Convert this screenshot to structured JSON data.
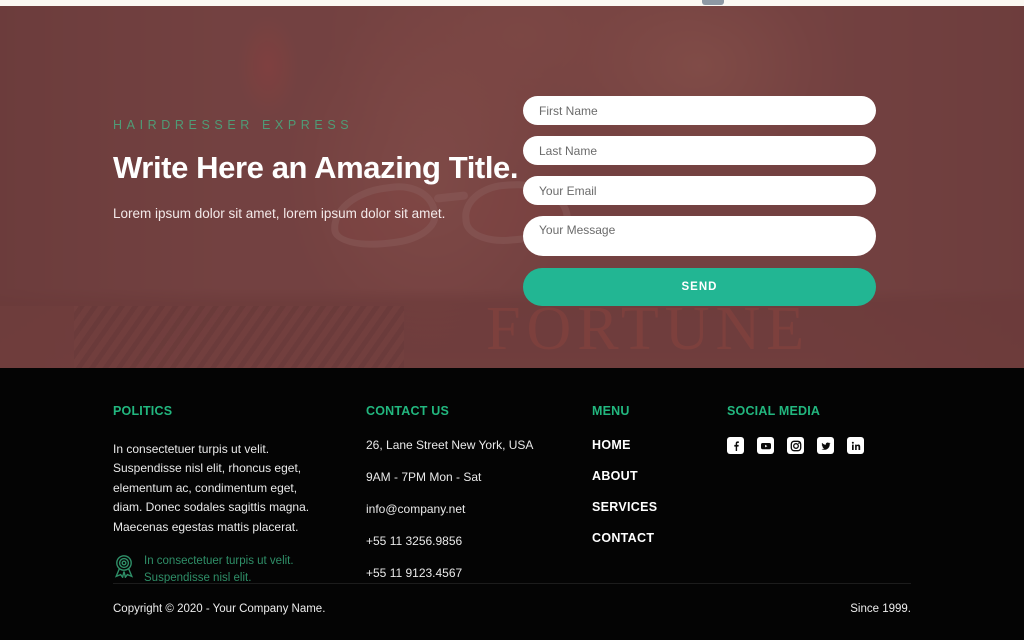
{
  "colors": {
    "accent_green": "#22b693",
    "footer_heading_green": "#22b77f",
    "hero_overlay": "#754343",
    "footer_bg": "#040404",
    "white": "#ffffff"
  },
  "hero": {
    "eyebrow": "HAIRDRESSER EXPRESS",
    "title": "Write Here an Amazing Title.",
    "subtitle": "Lorem ipsum dolor sit amet, lorem ipsum dolor sit amet.",
    "magazine_masthead": "FORTUNE",
    "form": {
      "first_name": {
        "placeholder": "First Name",
        "value": ""
      },
      "last_name": {
        "placeholder": "Last Name",
        "value": ""
      },
      "email": {
        "placeholder": "Your Email",
        "value": ""
      },
      "message": {
        "placeholder": "Your Message",
        "value": ""
      },
      "send_label": "SEND"
    }
  },
  "footer": {
    "politics": {
      "heading": "POLITICS",
      "body": "In consectetuer turpis ut velit. Suspendisse nisl elit, rhoncus eget, elementum ac, condimentum eget, diam. Donec sodales sagittis magna. Maecenas egestas mattis placerat.",
      "award_icon": "award-badge-icon",
      "award_text": "In consectetuer turpis ut velit. Suspendisse nisl elit."
    },
    "contact": {
      "heading": "CONTACT US",
      "lines": [
        "26, Lane Street New York, USA",
        "9AM - 7PM Mon - Sat",
        "info@company.net",
        "+55 11 3256.9856",
        "+55 11 9123.4567"
      ]
    },
    "menu": {
      "heading": "MENU",
      "items": [
        {
          "label": "HOME"
        },
        {
          "label": "ABOUT"
        },
        {
          "label": "SERVICES"
        },
        {
          "label": "CONTACT"
        }
      ]
    },
    "social": {
      "heading": "SOCIAL MEDIA",
      "items": [
        {
          "name": "facebook-icon"
        },
        {
          "name": "youtube-icon"
        },
        {
          "name": "instagram-icon"
        },
        {
          "name": "twitter-icon"
        },
        {
          "name": "linkedin-icon"
        }
      ]
    },
    "bottom": {
      "copyright": "Copyright © 2020 - Your Company Name.",
      "since": "Since 1999."
    }
  }
}
